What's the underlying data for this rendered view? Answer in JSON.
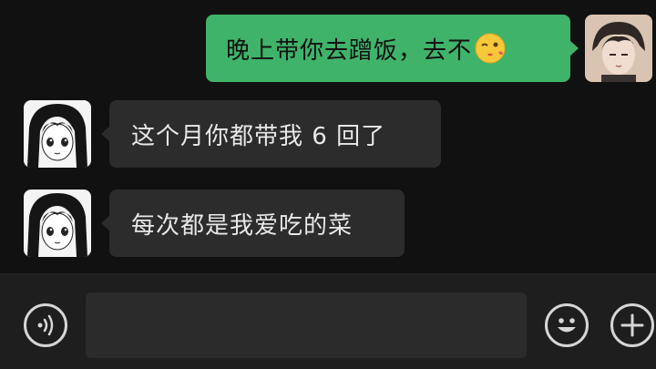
{
  "messages": [
    {
      "side": "sent",
      "text": "晚上带你去蹭饭，去不",
      "emoji": "wink-kiss-emoji"
    },
    {
      "side": "received",
      "text": "这个月你都带我 6 回了"
    },
    {
      "side": "received",
      "text": "每次都是我爱吃的菜"
    }
  ],
  "input_bar": {
    "message_value": "",
    "voice_icon": "voice-icon",
    "emoji_icon": "smiley-icon",
    "more_icon": "plus-icon"
  },
  "colors": {
    "background": "#111111",
    "sent_bubble": "#3fb36a",
    "received_bubble": "#2c2c2c",
    "input_bar": "#1e1e1e"
  }
}
